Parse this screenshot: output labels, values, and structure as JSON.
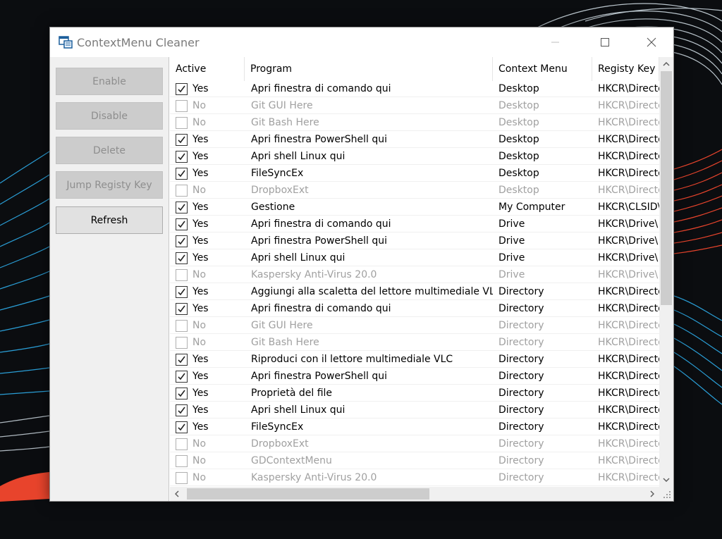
{
  "window": {
    "title": "ContextMenu Cleaner"
  },
  "buttons": [
    {
      "label": "Enable",
      "enabled": false
    },
    {
      "label": "Disable",
      "enabled": false
    },
    {
      "label": "Delete",
      "enabled": false
    },
    {
      "label": "Jump Registy Key",
      "enabled": false
    },
    {
      "label": "Refresh",
      "enabled": true
    }
  ],
  "table": {
    "columns": [
      "Active",
      "Program",
      "Context Menu",
      "Registy Key"
    ],
    "rows": [
      {
        "checked": true,
        "active": "Yes",
        "program": "Apri finestra di comando qui",
        "context": "Desktop",
        "key": "HKCR\\Directo"
      },
      {
        "checked": false,
        "active": "No",
        "program": "Git GUI Here",
        "context": "Desktop",
        "key": "HKCR\\Directo"
      },
      {
        "checked": false,
        "active": "No",
        "program": "Git Bash Here",
        "context": "Desktop",
        "key": "HKCR\\Directo"
      },
      {
        "checked": true,
        "active": "Yes",
        "program": "Apri finestra PowerShell qui",
        "context": "Desktop",
        "key": "HKCR\\Directo"
      },
      {
        "checked": true,
        "active": "Yes",
        "program": "Apri shell Linux qui",
        "context": "Desktop",
        "key": "HKCR\\Directo"
      },
      {
        "checked": true,
        "active": "Yes",
        "program": " FileSyncEx",
        "context": "Desktop",
        "key": "HKCR\\Directo"
      },
      {
        "checked": false,
        "active": "No",
        "program": "DropboxExt",
        "context": "Desktop",
        "key": "HKCR\\Directo"
      },
      {
        "checked": true,
        "active": "Yes",
        "program": "Gestione",
        "context": "My Computer",
        "key": "HKCR\\CLSID\\"
      },
      {
        "checked": true,
        "active": "Yes",
        "program": "Apri finestra di comando qui",
        "context": "Drive",
        "key": "HKCR\\Drive\\"
      },
      {
        "checked": true,
        "active": "Yes",
        "program": "Apri finestra PowerShell qui",
        "context": "Drive",
        "key": "HKCR\\Drive\\"
      },
      {
        "checked": true,
        "active": "Yes",
        "program": "Apri shell Linux qui",
        "context": "Drive",
        "key": "HKCR\\Drive\\"
      },
      {
        "checked": false,
        "active": "No",
        "program": "Kaspersky Anti-Virus 20.0",
        "context": "Drive",
        "key": "HKCR\\Drive\\"
      },
      {
        "checked": true,
        "active": "Yes",
        "program": "Aggiungi alla scaletta del lettore multimediale VLC",
        "context": "Directory",
        "key": "HKCR\\Directo"
      },
      {
        "checked": true,
        "active": "Yes",
        "program": "Apri finestra di comando qui",
        "context": "Directory",
        "key": "HKCR\\Directo"
      },
      {
        "checked": false,
        "active": "No",
        "program": "Git GUI Here",
        "context": "Directory",
        "key": "HKCR\\Directo"
      },
      {
        "checked": false,
        "active": "No",
        "program": "Git Bash Here",
        "context": "Directory",
        "key": "HKCR\\Directo"
      },
      {
        "checked": true,
        "active": "Yes",
        "program": "Riproduci con il lettore multimediale VLC",
        "context": "Directory",
        "key": "HKCR\\Directo"
      },
      {
        "checked": true,
        "active": "Yes",
        "program": "Apri finestra PowerShell qui",
        "context": "Directory",
        "key": "HKCR\\Directo"
      },
      {
        "checked": true,
        "active": "Yes",
        "program": "Proprietà del file",
        "context": "Directory",
        "key": "HKCR\\Directo"
      },
      {
        "checked": true,
        "active": "Yes",
        "program": "Apri shell Linux qui",
        "context": "Directory",
        "key": "HKCR\\Directo"
      },
      {
        "checked": true,
        "active": "Yes",
        "program": " FileSyncEx",
        "context": "Directory",
        "key": "HKCR\\Directo"
      },
      {
        "checked": false,
        "active": "No",
        "program": "DropboxExt",
        "context": "Directory",
        "key": "HKCR\\Directo"
      },
      {
        "checked": false,
        "active": "No",
        "program": "GDContextMenu",
        "context": "Directory",
        "key": "HKCR\\Directo"
      },
      {
        "checked": false,
        "active": "No",
        "program": "Kaspersky Anti-Virus 20.0",
        "context": "Directory",
        "key": "HKCR\\Directo"
      }
    ]
  },
  "icons": {
    "app": "app-icon",
    "minimize": "minimize-icon",
    "maximize": "maximize-icon",
    "close": "close-icon",
    "check": "checkmark-icon"
  },
  "colors": {
    "disabled_text": "#a0a0a0",
    "button_disabled_bg": "#cccccc",
    "accent_red": "#e8442c",
    "accent_blue": "#2a9ed6"
  }
}
